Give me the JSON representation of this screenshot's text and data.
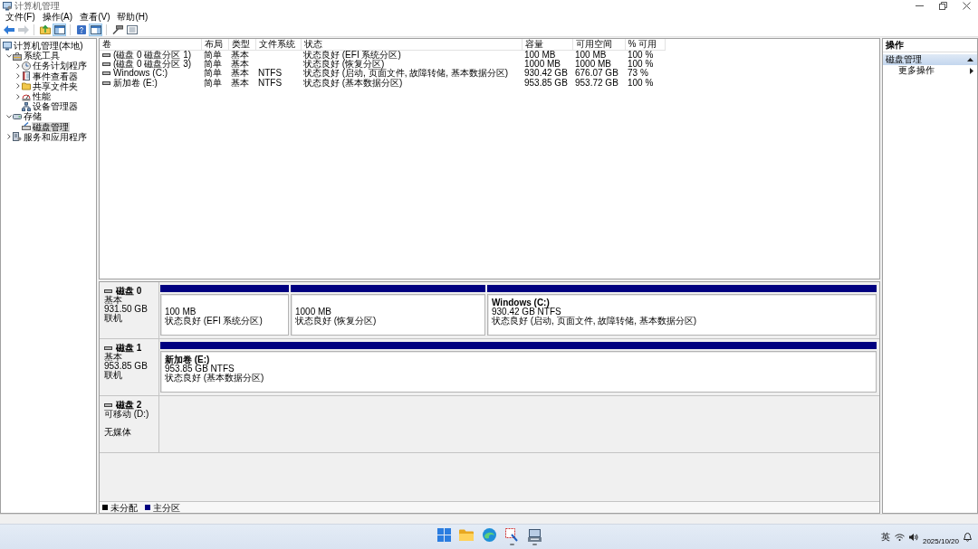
{
  "window": {
    "title": "计算机管理"
  },
  "menu": [
    "文件(F)",
    "操作(A)",
    "查看(V)",
    "帮助(H)"
  ],
  "toolbar": [
    {
      "pressed": false,
      "disabled": false
    },
    {
      "pressed": false,
      "disabled": true
    },
    {
      "pressed": false,
      "disabled": false
    },
    {
      "pressed": true,
      "disabled": false
    },
    {
      "pressed": false,
      "disabled": false
    },
    {
      "pressed": true,
      "disabled": false
    },
    {
      "pressed": false,
      "disabled": false
    },
    {
      "pressed": false,
      "disabled": false
    }
  ],
  "tree": {
    "items": [
      {
        "label": "计算机管理(本地)",
        "selected": false,
        "children": [
          {
            "label": "系统工具",
            "expanded": true,
            "selected": false,
            "children": [
              {
                "label": "任务计划程序",
                "expanded": false,
                "selected": false
              },
              {
                "label": "事件查看器",
                "expanded": false,
                "selected": false
              },
              {
                "label": "共享文件夹",
                "expanded": false,
                "selected": false
              },
              {
                "label": "性能",
                "expanded": false,
                "selected": false
              },
              {
                "label": "设备管理器",
                "selected": false
              }
            ]
          },
          {
            "label": "存储",
            "expanded": true,
            "selected": false,
            "children": [
              {
                "label": "磁盘管理",
                "selected": true
              }
            ]
          },
          {
            "label": "服务和应用程序",
            "expanded": false,
            "selected": false
          }
        ]
      }
    ]
  },
  "volumes": {
    "columns": [
      "卷",
      "布局",
      "类型",
      "文件系统",
      "状态",
      "容量",
      "可用空间",
      "% 可用"
    ],
    "rows": [
      {
        "volume": "(磁盘 0 磁盘分区 1)",
        "layout": "简单",
        "type": "基本",
        "status": "状态良好 (EFI 系统分区)",
        "capacity": "100 MB",
        "free_space": "100 MB",
        "percent_free": "100 %"
      },
      {
        "volume": "(磁盘 0 磁盘分区 3)",
        "layout": "简单",
        "type": "基本",
        "status": "状态良好 (恢复分区)",
        "capacity": "1000 MB",
        "free_space": "1000 MB",
        "percent_free": "100 %"
      },
      {
        "volume": "Windows (C:)",
        "layout": "简单",
        "type": "基本",
        "file_system": "NTFS",
        "status": "状态良好 (启动, 页面文件, 故障转储, 基本数据分区)",
        "capacity": "930.42 GB",
        "free_space": "676.07 GB",
        "percent_free": "73 %"
      },
      {
        "volume": "新加卷 (E:)",
        "layout": "简单",
        "type": "基本",
        "file_system": "NTFS",
        "status": "状态良好 (基本数据分区)",
        "capacity": "953.85 GB",
        "free_space": "953.72 GB",
        "percent_free": "100 %"
      }
    ]
  },
  "disk_map": {
    "disks": [
      {
        "name": "磁盘 0",
        "type": "基本",
        "size": "931.50 GB",
        "status": "联机",
        "partitions": [
          {
            "size": "100 MB",
            "status": "状态良好 (EFI 系统分区)",
            "color": "#000080"
          },
          {
            "size": "1000 MB",
            "status": "状态良好 (恢复分区)",
            "color": "#000080"
          },
          {
            "name": "Windows (C:)",
            "size": "930.42 GB NTFS",
            "status": "状态良好 (启动, 页面文件, 故障转储, 基本数据分区)",
            "color": "#000080"
          }
        ]
      },
      {
        "name": "磁盘 1",
        "type": "基本",
        "size": "953.85 GB",
        "status": "联机",
        "partitions": [
          {
            "name": "新加卷 (E:)",
            "size": "953.85 GB NTFS",
            "status": "状态良好 (基本数据分区)",
            "color": "#000080"
          }
        ]
      },
      {
        "name": "磁盘 2",
        "type": "可移动 (D:)",
        "status": "无媒体"
      }
    ],
    "legend": [
      {
        "label": "未分配",
        "color": "#000000"
      },
      {
        "label": "主分区",
        "color": "#000080"
      }
    ]
  },
  "actions": {
    "title": "操作",
    "sections": [
      {
        "label": "磁盘管理",
        "expanded": true,
        "items": [
          "更多操作"
        ]
      }
    ]
  },
  "taskbar": {
    "apps": [
      {
        "running": false
      },
      {
        "running": false
      },
      {
        "running": false
      },
      {
        "running": true
      },
      {
        "running": true
      }
    ],
    "tray": {
      "input_method": "英",
      "date": "2025/10/20"
    }
  }
}
